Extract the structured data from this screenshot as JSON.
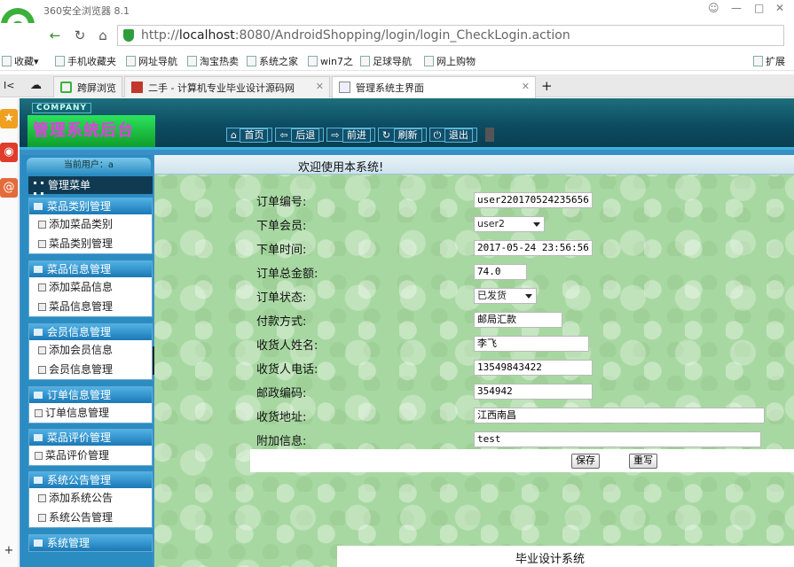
{
  "browser": {
    "title": "360安全浏览器 8.1",
    "url_host": "localhost",
    "url_prefix": "http://",
    "url_rest": ":8080/AndroidShopping/login/login_CheckLogin.action",
    "bookmarks": [
      "收藏",
      "手机收藏夹",
      "网址导航",
      "淘宝热卖",
      "系统之家",
      "win7之",
      "足球导航",
      "网上购物"
    ],
    "extension_label": "扩展",
    "tabs": [
      {
        "label": "I<"
      },
      {
        "label": "跨屏浏览"
      },
      {
        "label": "二手 - 计算机专业毕业设计源码网"
      },
      {
        "label": "管理系统主界面"
      }
    ],
    "new_tab": "+"
  },
  "header": {
    "company": "COMPANY",
    "title": "管理系统后台",
    "nav": [
      "首页",
      "后退",
      "前进",
      "刷新",
      "退出"
    ]
  },
  "sidebar": {
    "current_user": "当前用户：a",
    "menu_title": "管理菜单",
    "groups": [
      {
        "title": "菜品类别管理",
        "items": [
          "添加菜品类别",
          "菜品类别管理"
        ]
      },
      {
        "title": "菜品信息管理",
        "items": [
          "添加菜品信息",
          "菜品信息管理"
        ]
      },
      {
        "title": "会员信息管理",
        "items": [
          "添加会员信息",
          "会员信息管理"
        ]
      },
      {
        "title": "订单信息管理",
        "items": [
          "订单信息管理"
        ]
      },
      {
        "title": "菜品评价管理",
        "items": [
          "菜品评价管理"
        ]
      },
      {
        "title": "系统公告管理",
        "items": [
          "添加系统公告",
          "系统公告管理"
        ]
      },
      {
        "title": "系统管理",
        "items": []
      }
    ]
  },
  "content": {
    "welcome": "欢迎使用本系统!",
    "form": {
      "order_no": {
        "label": "订单编号:",
        "value": "user220170524235656"
      },
      "member": {
        "label": "下单会员:",
        "value": "user2"
      },
      "order_time": {
        "label": "下单时间:",
        "value": "2017-05-24 23:56:56"
      },
      "total": {
        "label": "订单总金额:",
        "value": "74.0"
      },
      "status": {
        "label": "订单状态:",
        "value": "已发货"
      },
      "payment": {
        "label": "付款方式:",
        "value": "邮局汇款"
      },
      "receiver": {
        "label": "收货人姓名:",
        "value": "李飞"
      },
      "phone": {
        "label": "收货人电话:",
        "value": "13549843422"
      },
      "postcode": {
        "label": "邮政编码:",
        "value": "354942"
      },
      "address": {
        "label": "收货地址:",
        "value": "江西南昌"
      },
      "extra": {
        "label": "附加信息:",
        "value": "test"
      }
    },
    "save_label": "保存",
    "reset_label": "重写"
  },
  "footer": {
    "text": "毕业设计系统"
  },
  "colors": {
    "header": "#0d4c62",
    "sidebar": "#2b8cc2",
    "title_bg": "#1fc746",
    "title_text": "#e040e0"
  }
}
